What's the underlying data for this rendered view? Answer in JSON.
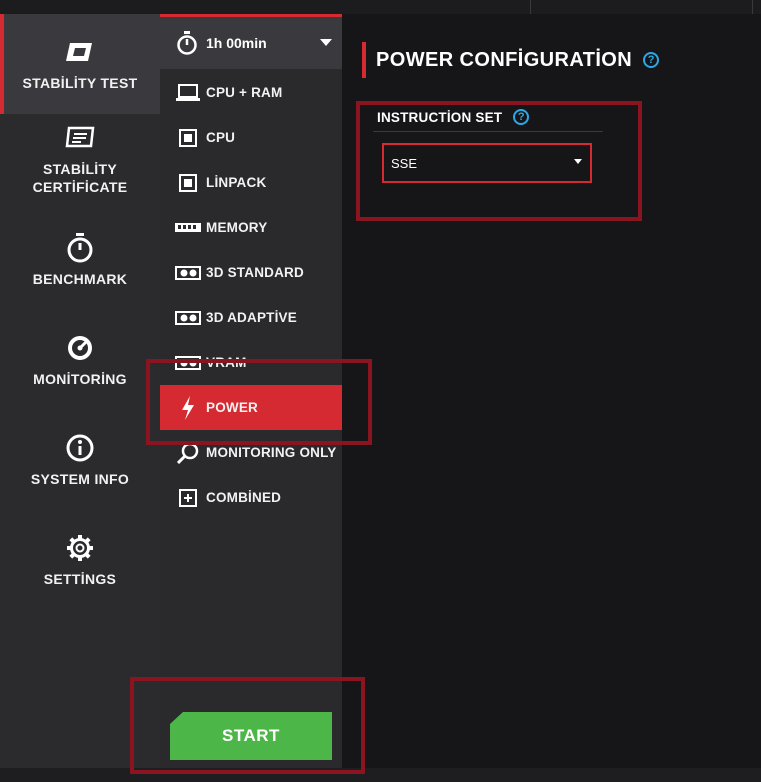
{
  "nav": {
    "items": [
      {
        "id": "stability-test",
        "label": "STABİLİTY TEST",
        "icon": "stability-icon",
        "active": true
      },
      {
        "id": "stability-certificate",
        "label": "STABİLİTY\nCERTİFİCATE",
        "icon": "certificate-icon",
        "active": false
      },
      {
        "id": "benchmark",
        "label": "BENCHMARK",
        "icon": "stopwatch-icon",
        "active": false
      },
      {
        "id": "monitoring",
        "label": "MONİTORİNG",
        "icon": "gauge-icon",
        "active": false
      },
      {
        "id": "system-info",
        "label": "SYSTEM INFO",
        "icon": "info-icon",
        "active": false
      },
      {
        "id": "settings",
        "label": "SETTİNGS",
        "icon": "gear-icon",
        "active": false
      }
    ]
  },
  "menu": {
    "duration": "1h 00min",
    "items": [
      {
        "id": "cpu-ram",
        "label": "CPU + RAM",
        "icon": "laptop-icon"
      },
      {
        "id": "cpu",
        "label": "CPU",
        "icon": "cpu-icon"
      },
      {
        "id": "linpack",
        "label": "LİNPACK",
        "icon": "linpack-icon"
      },
      {
        "id": "memory",
        "label": "MEMORY",
        "icon": "memory-icon"
      },
      {
        "id": "3d-standard",
        "label": "3D STANDARD",
        "icon": "gpu-icon"
      },
      {
        "id": "3d-adaptive",
        "label": "3D ADAPTİVE",
        "icon": "gpu-icon"
      },
      {
        "id": "vram",
        "label": "VRAM",
        "icon": "gpu-icon"
      },
      {
        "id": "power",
        "label": "POWER",
        "icon": "lightning-icon",
        "active": true
      },
      {
        "id": "monitoring-only",
        "label": "MONITORING ONLY",
        "icon": "magnifier-icon"
      },
      {
        "id": "combined",
        "label": "COMBİNED",
        "icon": "plus-box-icon"
      }
    ],
    "start_label": "START"
  },
  "main": {
    "title": "POWER CONFİGURATİON",
    "help_glyph": "?",
    "instruction_set": {
      "label": "INSTRUCTİON SET",
      "value": "SSE"
    }
  },
  "colors": {
    "accent": "#d62a33",
    "start": "#4cb648",
    "help": "#2aa8e8",
    "annotation": "#8a1420"
  }
}
